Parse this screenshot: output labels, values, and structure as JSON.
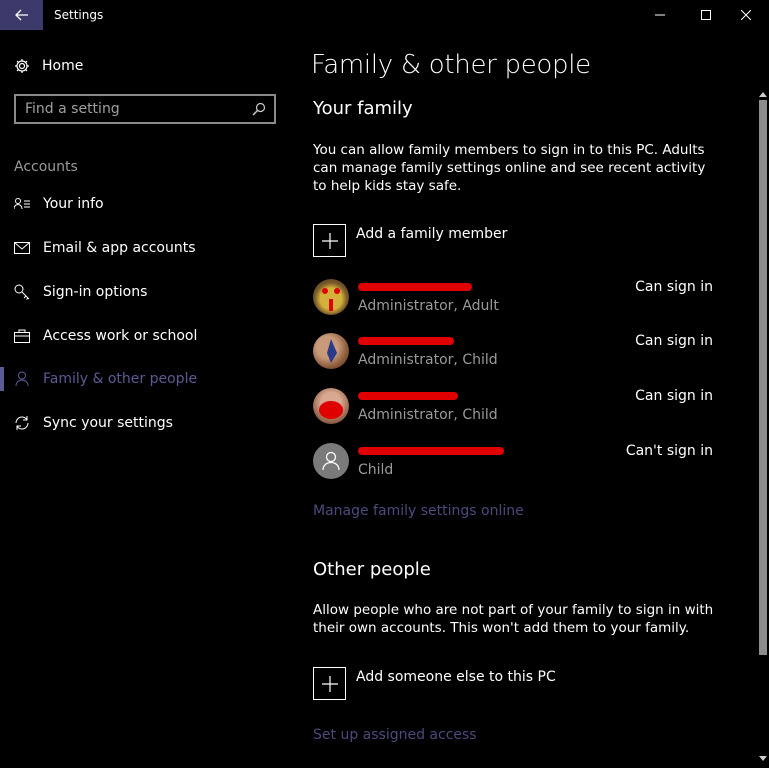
{
  "window": {
    "title": "Settings"
  },
  "sidebar": {
    "home_label": "Home",
    "search_placeholder": "Find a setting",
    "section_label": "Accounts",
    "items": [
      {
        "label": "Your info",
        "icon": "person-card-icon"
      },
      {
        "label": "Email & app accounts",
        "icon": "mail-icon"
      },
      {
        "label": "Sign-in options",
        "icon": "key-icon"
      },
      {
        "label": "Access work or school",
        "icon": "briefcase-icon"
      },
      {
        "label": "Family & other people",
        "icon": "person-icon",
        "selected": true
      },
      {
        "label": "Sync your settings",
        "icon": "sync-icon"
      }
    ]
  },
  "main": {
    "title": "Family & other people",
    "family": {
      "heading": "Your family",
      "description": "You can allow family members to sign in to this PC. Adults can manage family settings online and see recent activity to help kids stay safe.",
      "add_label": "Add a family member",
      "members": [
        {
          "role": "Administrator, Adult",
          "status": "Can sign in"
        },
        {
          "role": "Administrator, Child",
          "status": "Can sign in"
        },
        {
          "role": "Administrator, Child",
          "status": "Can sign in"
        },
        {
          "role": "Child",
          "status": "Can't sign in"
        }
      ],
      "manage_link": "Manage family settings online"
    },
    "other": {
      "heading": "Other people",
      "description": "Allow people who are not part of your family to sign in with their own accounts. This won't add them to your family.",
      "add_label": "Add someone else to this PC",
      "assigned_access_link": "Set up assigned access"
    }
  },
  "colors": {
    "accent": "#5b5a93",
    "back_button": "#3b3a6b",
    "redaction": "#e00000",
    "muted_text": "#9a9a9a"
  }
}
